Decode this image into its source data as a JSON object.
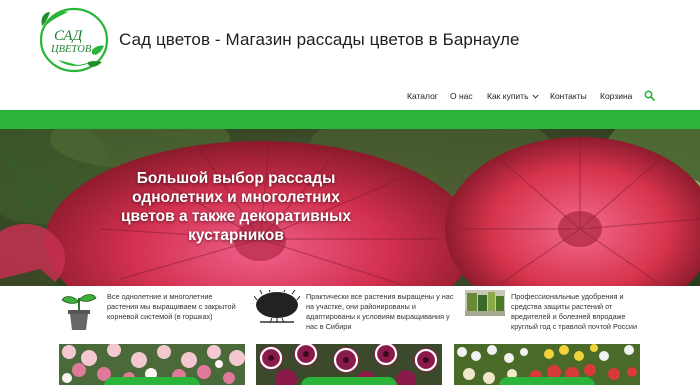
{
  "header": {
    "logo_line1": "САД",
    "logo_line2": "ЦВЕТОВ",
    "site_title": "Сад цветов - Магазин рассады цветов в Барнауле"
  },
  "nav": {
    "items": [
      "Каталог",
      "О нас",
      "Как купить",
      "Контакты",
      "Корзина"
    ]
  },
  "hero": {
    "line1": "Большой выбор рассады",
    "line2": "однолетних и многолетних",
    "line3": "цветов а также декоративных",
    "line4": "кустарников"
  },
  "features": [
    {
      "icon": "seedling-pot-icon",
      "lines": [
        "Все однолетние и многолетние",
        "растения мы выращиваем с закрытой",
        "корневой системой (в горшках)"
      ]
    },
    {
      "icon": "shrub-icon",
      "lines": [
        "Практически все растения выращены у нас",
        "на участке, они районированы и",
        "адаптированы к условиям выращивания у",
        "нас в Сибири"
      ]
    },
    {
      "icon": "fertilizer-photo-icon",
      "lines": [
        "Профессиональные удобрения и",
        "средства защиты растений от",
        "вредителей и болезней впродаже",
        "круглый год с травлой почтой России"
      ]
    }
  ],
  "colors": {
    "accent": "#2ab43a",
    "title_text": "#1e1e1e"
  }
}
